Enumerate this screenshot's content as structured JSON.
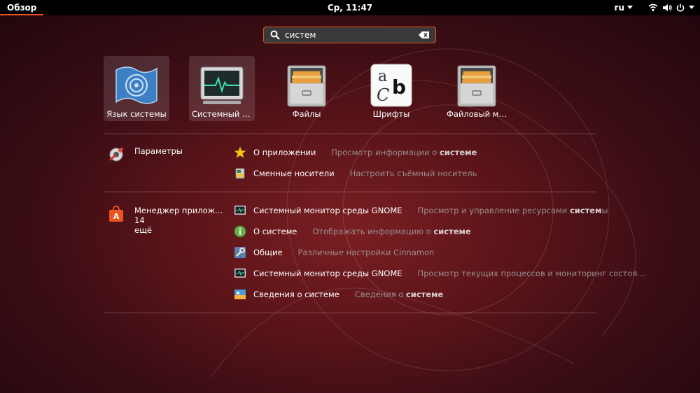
{
  "topbar": {
    "overview": "Обзор",
    "clock": "Ср, 11:47",
    "lang": "ru"
  },
  "search": {
    "value": "систем"
  },
  "apps": [
    {
      "label": "Язык системы",
      "icon": "language-support-icon"
    },
    {
      "label": "Системный м…",
      "icon": "system-monitor-icon"
    },
    {
      "label": "Файлы",
      "icon": "file-cabinet-icon"
    },
    {
      "label": "Шрифты",
      "icon": "fonts-icon"
    },
    {
      "label": "Файловый ме…",
      "icon": "file-cabinet-icon"
    }
  ],
  "provider1": {
    "name": "Параметры",
    "icon": "settings-icon",
    "results": [
      {
        "name": "О приложении",
        "desc_pre": "Просмотр информации о ",
        "desc_bold": "системе",
        "desc_post": "",
        "icon": "star-icon"
      },
      {
        "name": "Сменные носители",
        "desc_pre": "Настроить съёмный носитель",
        "desc_bold": "",
        "desc_post": "",
        "icon": "removable-media-icon"
      }
    ]
  },
  "provider2": {
    "name": "Менеджер прилож…",
    "more": "14 ещё",
    "icon": "software-center-icon",
    "results": [
      {
        "name": "Системный монитор среды GNOME",
        "desc_pre": "Просмотр и управление ресурсами ",
        "desc_bold": "систем",
        "desc_post": "ы",
        "icon": "system-monitor-icon"
      },
      {
        "name": "О системе",
        "desc_pre": "Отображать информацию о ",
        "desc_bold": "системе",
        "desc_post": "",
        "icon": "info-icon"
      },
      {
        "name": "Общие",
        "desc_pre": "Различные настройки Cinnamon",
        "desc_bold": "",
        "desc_post": "",
        "icon": "tools-icon"
      },
      {
        "name": "Системный монитор среды GNOME",
        "desc_pre": "Просмотр текущих процессов и мониторинг состоя…",
        "desc_bold": "",
        "desc_post": "",
        "icon": "system-monitor-icon"
      },
      {
        "name": "Сведения о системе",
        "desc_pre": "Сведения о ",
        "desc_bold": "системе",
        "desc_post": "",
        "icon": "system-info-icon"
      }
    ]
  }
}
